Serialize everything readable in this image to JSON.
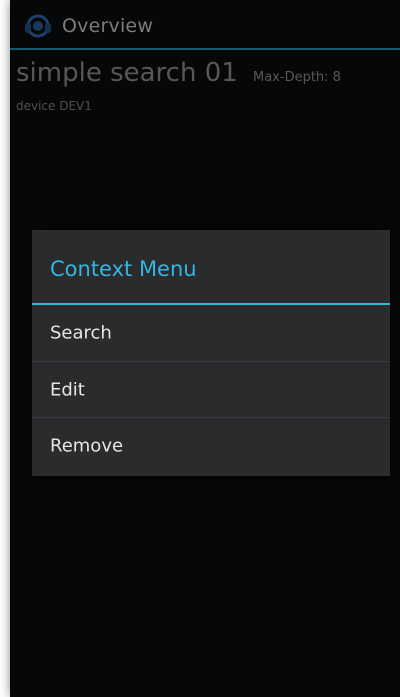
{
  "app": {
    "title": "Overview",
    "icon": "app-logo-icon",
    "accent_color": "#33b5e5"
  },
  "item": {
    "title": "simple search 01",
    "max_depth": "Max-Depth: 8",
    "device": "device  DEV1"
  },
  "context_menu": {
    "title": "Context Menu",
    "items": [
      {
        "label": "Search"
      },
      {
        "label": "Edit"
      },
      {
        "label": "Remove"
      }
    ]
  }
}
